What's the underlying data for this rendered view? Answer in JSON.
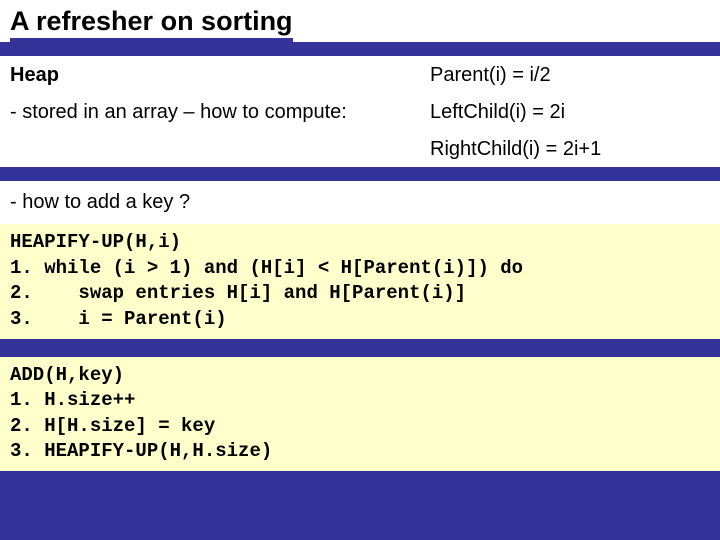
{
  "title": "A refresher on sorting",
  "heap_label": "Heap",
  "stored_line": "- stored in an array – how to compute:",
  "parent_eq": "Parent(i) = i/2",
  "left_eq": "LeftChild(i) = 2i",
  "right_eq": "RightChild(i) = 2i+1",
  "how_add": "- how to add a key ?",
  "code1": "HEAPIFY-UP(H,i)\n1. while (i > 1) and (H[i] < H[Parent(i)]) do\n2.    swap entries H[i] and H[Parent(i)]\n3.    i = Parent(i)",
  "code2": "ADD(H,key)\n1. H.size++\n2. H[H.size] = key\n3. HEAPIFY-UP(H,H.size)"
}
